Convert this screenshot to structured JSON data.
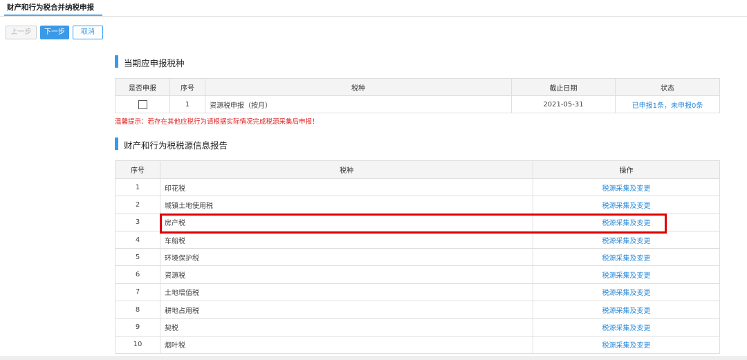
{
  "header": {
    "tab_title": "财产和行为税合并纳税申报"
  },
  "toolbar": {
    "prev_label": "上一步",
    "next_label": "下一步",
    "cancel_label": "取消"
  },
  "section1": {
    "title": "当期应申报税种",
    "columns": [
      "是否申报",
      "序号",
      "税种",
      "截止日期",
      "状态"
    ],
    "rows": [
      {
        "seq": "1",
        "tax": "资源税申报（按月）",
        "deadline": "2021-05-31",
        "status": "已申报1条，未申报0条"
      }
    ],
    "warning": "温馨提示：若存在其他应税行为请根据实际情况完成税源采集后申报！"
  },
  "section2": {
    "title": "财产和行为税税源信息报告",
    "columns": [
      "序号",
      "税种",
      "操作"
    ],
    "rows": [
      {
        "seq": "1",
        "tax": "印花税",
        "action": "税源采集及变更"
      },
      {
        "seq": "2",
        "tax": "城镇土地使用税",
        "action": "税源采集及变更"
      },
      {
        "seq": "3",
        "tax": "房产税",
        "action": "税源采集及变更"
      },
      {
        "seq": "4",
        "tax": "车船税",
        "action": "税源采集及变更"
      },
      {
        "seq": "5",
        "tax": "环境保护税",
        "action": "税源采集及变更"
      },
      {
        "seq": "6",
        "tax": "资源税",
        "action": "税源采集及变更"
      },
      {
        "seq": "7",
        "tax": "土地增值税",
        "action": "税源采集及变更"
      },
      {
        "seq": "8",
        "tax": "耕地占用税",
        "action": "税源采集及变更"
      },
      {
        "seq": "9",
        "tax": "契税",
        "action": "税源采集及变更"
      },
      {
        "seq": "10",
        "tax": "烟叶税",
        "action": "税源采集及变更"
      }
    ]
  },
  "colors": {
    "accent": "#3a9ae8",
    "link": "#2a8ad8",
    "warning": "#e02020",
    "highlight": "#e00000"
  }
}
